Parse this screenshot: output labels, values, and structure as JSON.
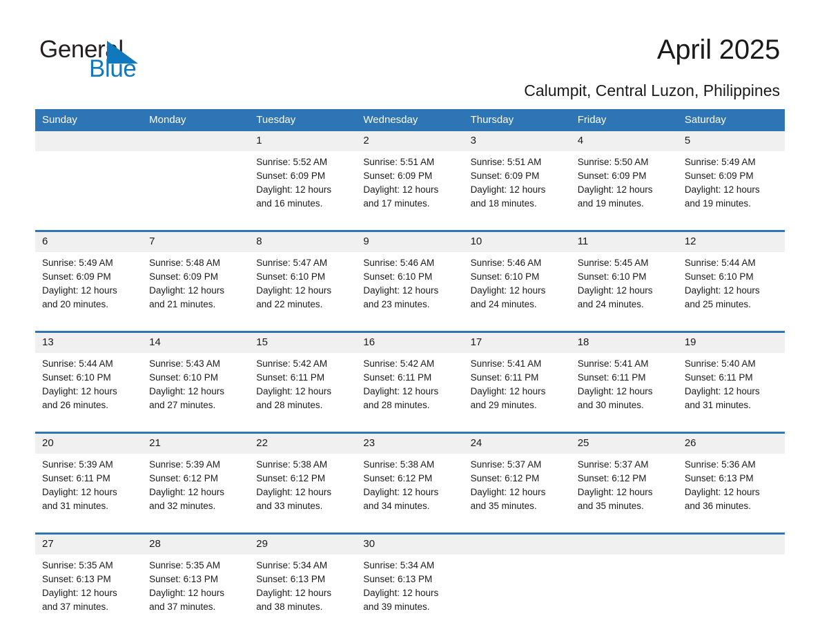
{
  "brand": {
    "name_dark": "General",
    "name_blue": "Blue",
    "triangle_color": "#1278be",
    "accent_color": "#2e75b6"
  },
  "header": {
    "month_title": "April 2025",
    "location": "Calumpit, Central Luzon, Philippines"
  },
  "calendar": {
    "weekday_headers": [
      "Sunday",
      "Monday",
      "Tuesday",
      "Wednesday",
      "Thursday",
      "Friday",
      "Saturday"
    ],
    "weeks": [
      {
        "daynums": [
          "",
          "",
          "1",
          "2",
          "3",
          "4",
          "5"
        ],
        "cells": [
          {
            "sunrise": "",
            "sunset": "",
            "daylight_a": "",
            "daylight_b": ""
          },
          {
            "sunrise": "",
            "sunset": "",
            "daylight_a": "",
            "daylight_b": ""
          },
          {
            "sunrise": "Sunrise: 5:52 AM",
            "sunset": "Sunset: 6:09 PM",
            "daylight_a": "Daylight: 12 hours",
            "daylight_b": "and 16 minutes."
          },
          {
            "sunrise": "Sunrise: 5:51 AM",
            "sunset": "Sunset: 6:09 PM",
            "daylight_a": "Daylight: 12 hours",
            "daylight_b": "and 17 minutes."
          },
          {
            "sunrise": "Sunrise: 5:51 AM",
            "sunset": "Sunset: 6:09 PM",
            "daylight_a": "Daylight: 12 hours",
            "daylight_b": "and 18 minutes."
          },
          {
            "sunrise": "Sunrise: 5:50 AM",
            "sunset": "Sunset: 6:09 PM",
            "daylight_a": "Daylight: 12 hours",
            "daylight_b": "and 19 minutes."
          },
          {
            "sunrise": "Sunrise: 5:49 AM",
            "sunset": "Sunset: 6:09 PM",
            "daylight_a": "Daylight: 12 hours",
            "daylight_b": "and 19 minutes."
          }
        ]
      },
      {
        "daynums": [
          "6",
          "7",
          "8",
          "9",
          "10",
          "11",
          "12"
        ],
        "cells": [
          {
            "sunrise": "Sunrise: 5:49 AM",
            "sunset": "Sunset: 6:09 PM",
            "daylight_a": "Daylight: 12 hours",
            "daylight_b": "and 20 minutes."
          },
          {
            "sunrise": "Sunrise: 5:48 AM",
            "sunset": "Sunset: 6:09 PM",
            "daylight_a": "Daylight: 12 hours",
            "daylight_b": "and 21 minutes."
          },
          {
            "sunrise": "Sunrise: 5:47 AM",
            "sunset": "Sunset: 6:10 PM",
            "daylight_a": "Daylight: 12 hours",
            "daylight_b": "and 22 minutes."
          },
          {
            "sunrise": "Sunrise: 5:46 AM",
            "sunset": "Sunset: 6:10 PM",
            "daylight_a": "Daylight: 12 hours",
            "daylight_b": "and 23 minutes."
          },
          {
            "sunrise": "Sunrise: 5:46 AM",
            "sunset": "Sunset: 6:10 PM",
            "daylight_a": "Daylight: 12 hours",
            "daylight_b": "and 24 minutes."
          },
          {
            "sunrise": "Sunrise: 5:45 AM",
            "sunset": "Sunset: 6:10 PM",
            "daylight_a": "Daylight: 12 hours",
            "daylight_b": "and 24 minutes."
          },
          {
            "sunrise": "Sunrise: 5:44 AM",
            "sunset": "Sunset: 6:10 PM",
            "daylight_a": "Daylight: 12 hours",
            "daylight_b": "and 25 minutes."
          }
        ]
      },
      {
        "daynums": [
          "13",
          "14",
          "15",
          "16",
          "17",
          "18",
          "19"
        ],
        "cells": [
          {
            "sunrise": "Sunrise: 5:44 AM",
            "sunset": "Sunset: 6:10 PM",
            "daylight_a": "Daylight: 12 hours",
            "daylight_b": "and 26 minutes."
          },
          {
            "sunrise": "Sunrise: 5:43 AM",
            "sunset": "Sunset: 6:10 PM",
            "daylight_a": "Daylight: 12 hours",
            "daylight_b": "and 27 minutes."
          },
          {
            "sunrise": "Sunrise: 5:42 AM",
            "sunset": "Sunset: 6:11 PM",
            "daylight_a": "Daylight: 12 hours",
            "daylight_b": "and 28 minutes."
          },
          {
            "sunrise": "Sunrise: 5:42 AM",
            "sunset": "Sunset: 6:11 PM",
            "daylight_a": "Daylight: 12 hours",
            "daylight_b": "and 28 minutes."
          },
          {
            "sunrise": "Sunrise: 5:41 AM",
            "sunset": "Sunset: 6:11 PM",
            "daylight_a": "Daylight: 12 hours",
            "daylight_b": "and 29 minutes."
          },
          {
            "sunrise": "Sunrise: 5:41 AM",
            "sunset": "Sunset: 6:11 PM",
            "daylight_a": "Daylight: 12 hours",
            "daylight_b": "and 30 minutes."
          },
          {
            "sunrise": "Sunrise: 5:40 AM",
            "sunset": "Sunset: 6:11 PM",
            "daylight_a": "Daylight: 12 hours",
            "daylight_b": "and 31 minutes."
          }
        ]
      },
      {
        "daynums": [
          "20",
          "21",
          "22",
          "23",
          "24",
          "25",
          "26"
        ],
        "cells": [
          {
            "sunrise": "Sunrise: 5:39 AM",
            "sunset": "Sunset: 6:11 PM",
            "daylight_a": "Daylight: 12 hours",
            "daylight_b": "and 31 minutes."
          },
          {
            "sunrise": "Sunrise: 5:39 AM",
            "sunset": "Sunset: 6:12 PM",
            "daylight_a": "Daylight: 12 hours",
            "daylight_b": "and 32 minutes."
          },
          {
            "sunrise": "Sunrise: 5:38 AM",
            "sunset": "Sunset: 6:12 PM",
            "daylight_a": "Daylight: 12 hours",
            "daylight_b": "and 33 minutes."
          },
          {
            "sunrise": "Sunrise: 5:38 AM",
            "sunset": "Sunset: 6:12 PM",
            "daylight_a": "Daylight: 12 hours",
            "daylight_b": "and 34 minutes."
          },
          {
            "sunrise": "Sunrise: 5:37 AM",
            "sunset": "Sunset: 6:12 PM",
            "daylight_a": "Daylight: 12 hours",
            "daylight_b": "and 35 minutes."
          },
          {
            "sunrise": "Sunrise: 5:37 AM",
            "sunset": "Sunset: 6:12 PM",
            "daylight_a": "Daylight: 12 hours",
            "daylight_b": "and 35 minutes."
          },
          {
            "sunrise": "Sunrise: 5:36 AM",
            "sunset": "Sunset: 6:13 PM",
            "daylight_a": "Daylight: 12 hours",
            "daylight_b": "and 36 minutes."
          }
        ]
      },
      {
        "daynums": [
          "27",
          "28",
          "29",
          "30",
          "",
          "",
          ""
        ],
        "cells": [
          {
            "sunrise": "Sunrise: 5:35 AM",
            "sunset": "Sunset: 6:13 PM",
            "daylight_a": "Daylight: 12 hours",
            "daylight_b": "and 37 minutes."
          },
          {
            "sunrise": "Sunrise: 5:35 AM",
            "sunset": "Sunset: 6:13 PM",
            "daylight_a": "Daylight: 12 hours",
            "daylight_b": "and 37 minutes."
          },
          {
            "sunrise": "Sunrise: 5:34 AM",
            "sunset": "Sunset: 6:13 PM",
            "daylight_a": "Daylight: 12 hours",
            "daylight_b": "and 38 minutes."
          },
          {
            "sunrise": "Sunrise: 5:34 AM",
            "sunset": "Sunset: 6:13 PM",
            "daylight_a": "Daylight: 12 hours",
            "daylight_b": "and 39 minutes."
          },
          {
            "sunrise": "",
            "sunset": "",
            "daylight_a": "",
            "daylight_b": ""
          },
          {
            "sunrise": "",
            "sunset": "",
            "daylight_a": "",
            "daylight_b": ""
          },
          {
            "sunrise": "",
            "sunset": "",
            "daylight_a": "",
            "daylight_b": ""
          }
        ]
      }
    ]
  }
}
